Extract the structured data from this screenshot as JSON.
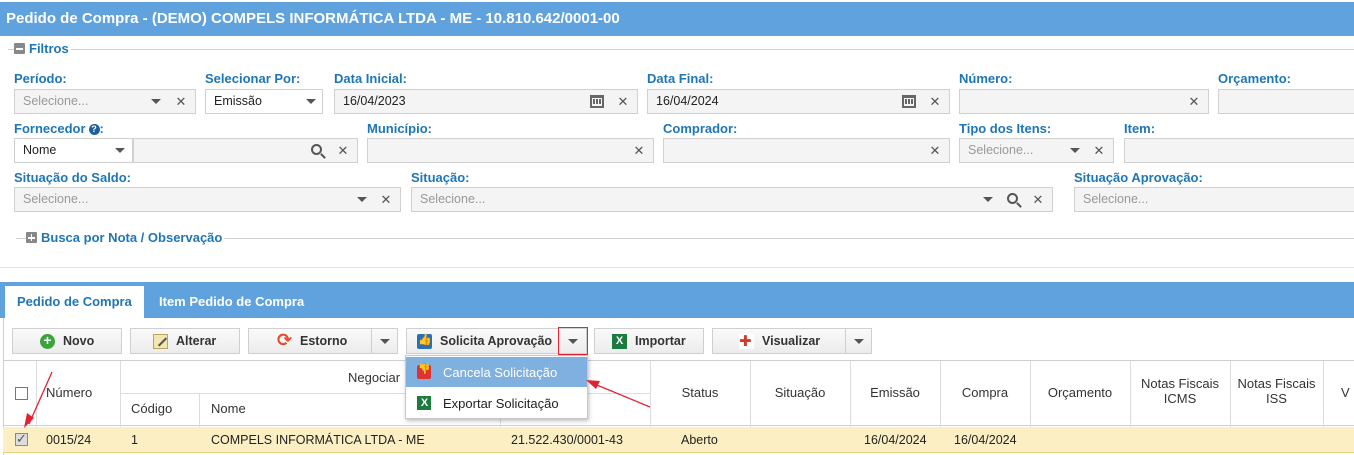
{
  "window": {
    "title": "Pedido de Compra - (DEMO) COMPELS INFORMÁTICA LTDA - ME - 10.810.642/0001-00"
  },
  "filters": {
    "legend": "Filtros",
    "periodo": {
      "label": "Período:",
      "placeholder": "Selecione..."
    },
    "selecionar_por": {
      "label": "Selecionar Por:",
      "value": "Emissão"
    },
    "data_inicial": {
      "label": "Data Inicial:",
      "value": "16/04/2023"
    },
    "data_final": {
      "label": "Data Final:",
      "value": "16/04/2024"
    },
    "numero": {
      "label": "Número:",
      "value": ""
    },
    "orcamento": {
      "label": "Orçamento:",
      "value": ""
    },
    "fornecedor": {
      "label": "Fornecedor",
      "mode": "Nome",
      "value": ""
    },
    "municipio": {
      "label": "Município:",
      "value": ""
    },
    "comprador": {
      "label": "Comprador:",
      "value": ""
    },
    "tipo_itens": {
      "label": "Tipo dos Itens:",
      "placeholder": "Selecione..."
    },
    "item": {
      "label": "Item:",
      "value": ""
    },
    "situacao_saldo": {
      "label": "Situação do Saldo:",
      "placeholder": "Selecione..."
    },
    "situacao": {
      "label": "Situação:",
      "placeholder": "Selecione..."
    },
    "situacao_aprovacao": {
      "label": "Situação Aprovação:",
      "placeholder": "Selecione..."
    },
    "busca_legend": "Busca por Nota / Observação"
  },
  "tabs": [
    {
      "label": "Pedido de Compra",
      "active": true
    },
    {
      "label": "Item Pedido de Compra",
      "active": false
    }
  ],
  "toolbar": {
    "novo": "Novo",
    "alterar": "Alterar",
    "estorno": "Estorno",
    "solicita_aprovacao": "Solicita Aprovação",
    "importar": "Importar",
    "visualizar": "Visualizar"
  },
  "dropdown_menu": {
    "items": [
      {
        "label": "Cancela Solicitação",
        "icon": "thumbs-down-icon",
        "highlighted": true
      },
      {
        "label": "Exportar Solicitação",
        "icon": "excel-icon",
        "highlighted": false
      }
    ]
  },
  "table": {
    "headers": {
      "numero": "Número",
      "negociante": "Negociar",
      "codigo": "Código",
      "nome": "Nome",
      "status": "Status",
      "situacao": "Situação",
      "emissao": "Emissão",
      "compra": "Compra",
      "orcamento": "Orçamento",
      "nf_icms_1": "Notas Fiscais",
      "nf_icms_2": "ICMS",
      "nf_iss_1": "Notas Fiscais",
      "nf_iss_2": "ISS",
      "last": "V"
    },
    "rows": [
      {
        "numero": "0015/24",
        "codigo": "1",
        "nome": "COMPELS INFORMÁTICA LTDA - ME",
        "documento": "21.522.430/0001-43",
        "status": "Aberto",
        "situacao": "",
        "emissao": "16/04/2024",
        "compra": "16/04/2024"
      }
    ]
  },
  "colors": {
    "header_blue": "#5fa2dd",
    "label_blue": "#1e76b5",
    "row_selected": "#fcefc4",
    "annotation_red": "#e22233"
  }
}
